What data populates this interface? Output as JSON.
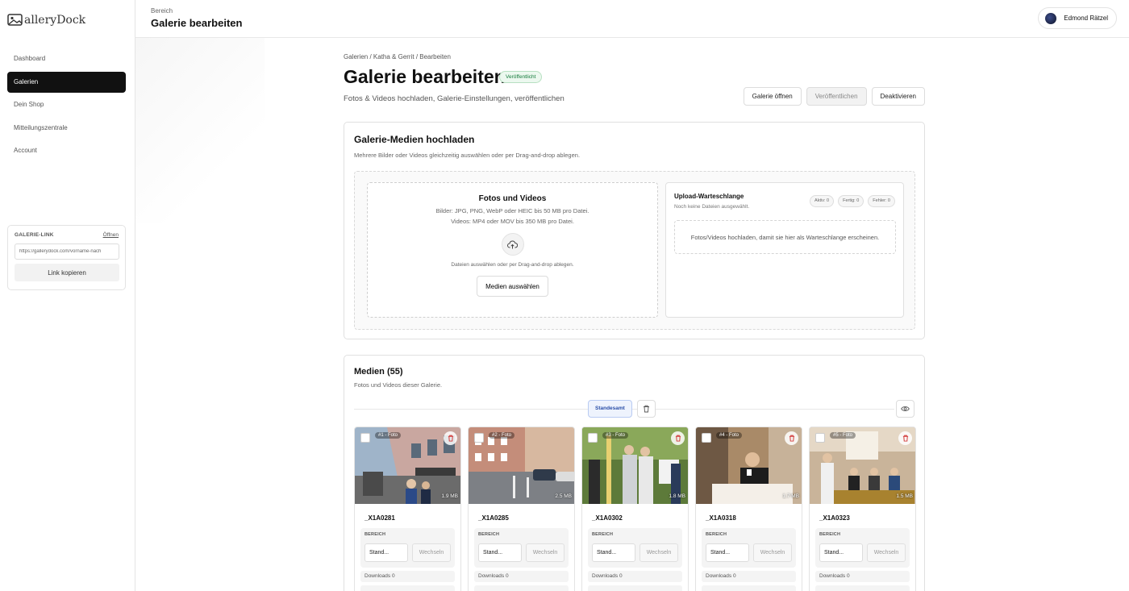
{
  "brand": {
    "name": "alleryDock"
  },
  "header": {
    "section": "Bereich",
    "title": "Galerie bearbeiten",
    "user": "Edmond Rätzel"
  },
  "sidebar": {
    "items": [
      {
        "label": "Dashboard"
      },
      {
        "label": "Galerien",
        "active": true
      },
      {
        "label": "Dein Shop"
      },
      {
        "label": "Mitteilungszentrale"
      },
      {
        "label": "Account"
      }
    ],
    "gallery_link": {
      "label": "GALERIE-LINK",
      "open_label": "Öffnen",
      "url": "https://gallerydock.com/vorname-nach",
      "copy_label": "Link kopieren"
    }
  },
  "page": {
    "breadcrumb": "Galerien / Katha & Gerrit / Bearbeiten",
    "title": "Galerie bearbeiten",
    "status": "Veröffentlicht",
    "subtitle": "Fotos & Videos hochladen, Galerie-Einstellungen, veröffentlichen",
    "actions": {
      "open": "Galerie öffnen",
      "publish": "Veröffentlichen",
      "deactivate": "Deaktivieren"
    }
  },
  "upload": {
    "title": "Galerie-Medien hochladen",
    "desc": "Mehrere Bilder oder Videos gleichzeitig auswählen oder per Drag-and-drop ablegen.",
    "dropzone": {
      "title": "Fotos und Videos",
      "line1": "Bilder: JPG, PNG, WebP oder HEIC bis 50 MB pro Datei.",
      "line2": "Videos: MP4 oder MOV bis 350 MB pro Datei.",
      "hint": "Dateien auswählen oder per Drag-and-drop ablegen.",
      "button": "Medien auswählen"
    },
    "queue": {
      "title": "Upload-Warteschlange",
      "subtitle": "Noch keine Dateien ausgewählt.",
      "active": "Aktiv: 0",
      "done": "Fertig: 0",
      "errors": "Fehler: 0",
      "empty": "Fotos/Videos hochladen, damit sie hier als Warteschlange erscheinen."
    }
  },
  "media": {
    "title": "Medien (55)",
    "desc": "Fotos und Videos dieser Galerie.",
    "filter": "Standesamt",
    "items": [
      {
        "tag": "#1 - Foto",
        "size": "1.9 MB",
        "name": "_X1A0281",
        "area_label": "BEREICH",
        "area": "Stand...",
        "switch": "Wechseln",
        "downloads": "Downloads 0"
      },
      {
        "tag": "#2 - Foto",
        "size": "2.5 MB",
        "name": "_X1A0285",
        "area_label": "BEREICH",
        "area": "Stand...",
        "switch": "Wechseln",
        "downloads": "Downloads 0"
      },
      {
        "tag": "#3 - Foto",
        "size": "1.8 MB",
        "name": "_X1A0302",
        "area_label": "BEREICH",
        "area": "Stand...",
        "switch": "Wechseln",
        "downloads": "Downloads 0"
      },
      {
        "tag": "#4 - Foto",
        "size": "1.7 MB",
        "name": "_X1A0318",
        "area_label": "BEREICH",
        "area": "Stand...",
        "switch": "Wechseln",
        "downloads": "Downloads 0"
      },
      {
        "tag": "#5 - Foto",
        "size": "1.5 MB",
        "name": "_X1A0323",
        "area_label": "BEREICH",
        "area": "Stand...",
        "switch": "Wechseln",
        "downloads": "Downloads 0"
      }
    ]
  },
  "colors": {
    "accent": "#111111",
    "published_green": "#137a3a",
    "filter_blue": "#2b4fa8",
    "delete_red": "#d23b3b"
  }
}
